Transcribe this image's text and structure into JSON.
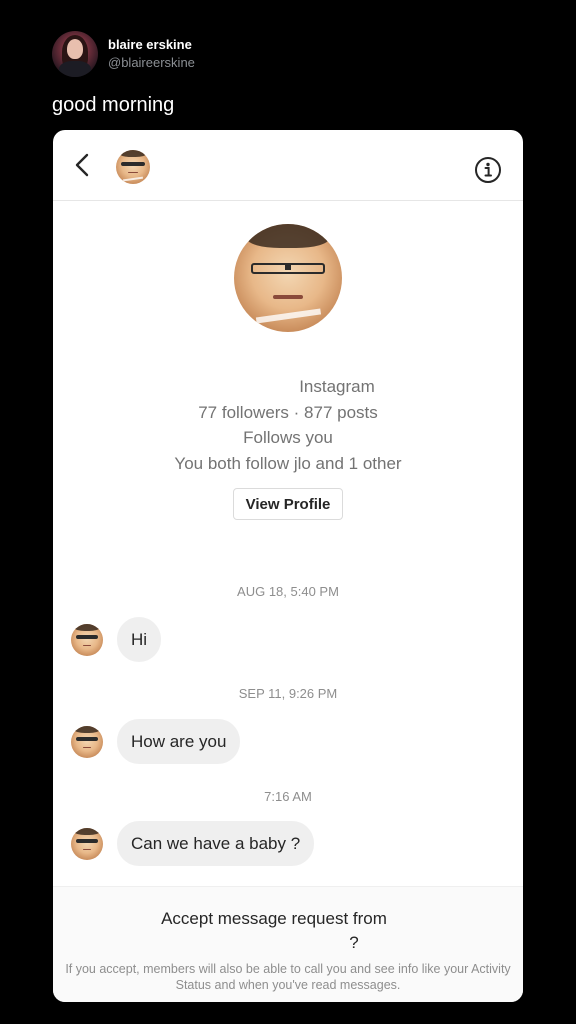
{
  "tweet": {
    "display_name": "blaire erskine",
    "handle": "@blaireerskine",
    "text": "good morning"
  },
  "screenshot": {
    "topbar": {
      "back_icon": "chevron-left-icon",
      "info_icon": "info-circle-icon"
    },
    "profile": {
      "platform": "Instagram",
      "stats": "77 followers · 877 posts",
      "follows_you": "Follows you",
      "mutuals": "You both follow jlo and 1 other",
      "view_profile_label": "View Profile"
    },
    "messages": [
      {
        "timestamp": "AUG 18, 5:40 PM",
        "text": "Hi"
      },
      {
        "timestamp": "SEP 11, 9:26 PM",
        "text": "How are you"
      },
      {
        "timestamp": "7:16 AM",
        "text": "Can we have a baby ?"
      }
    ],
    "request": {
      "title_line1": "Accept message request from",
      "title_line2": "?",
      "subtext": "If you accept, members will also be able to call you and see info like your Activity Status and when you've read messages."
    }
  },
  "colors": {
    "background": "#000000",
    "card": "#ffffff",
    "bubble": "#efefef",
    "muted_text": "#737373"
  }
}
